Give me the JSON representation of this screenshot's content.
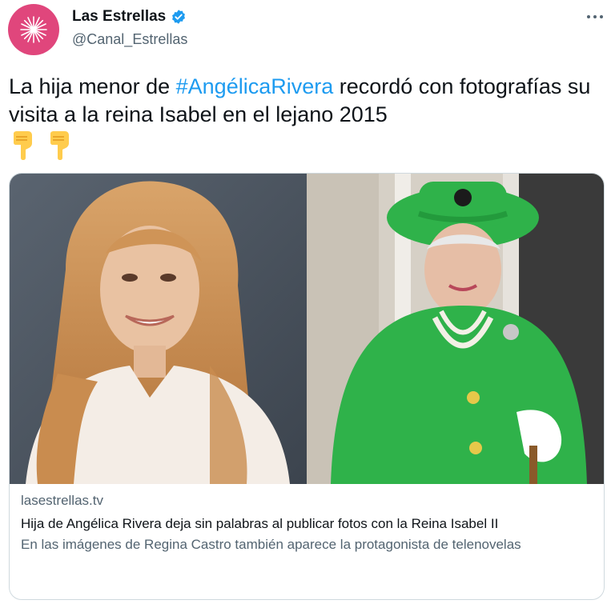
{
  "author": {
    "display_name": "Las Estrellas",
    "handle": "@Canal_Estrellas",
    "avatar_color": "#e0467c",
    "verified": true
  },
  "menu": {
    "more_icon": "more-horizontal-icon"
  },
  "tweet": {
    "text_before": "La hija menor de ",
    "hashtag": "#AngélicaRivera",
    "text_after": " recordó con fotografías su visita a la reina Isabel en el lejano 2015",
    "emojis": [
      "👇",
      "👇"
    ]
  },
  "card": {
    "domain": "lasestrellas.tv",
    "title": "Hija de Angélica Rivera deja sin palabras al publicar fotos con la Reina Isabel II",
    "description": "En las imágenes de Regina Castro también aparece la protagonista de telenovelas"
  },
  "colors": {
    "link": "#1d9bf0",
    "secondary_text": "#536471",
    "border": "#cfd9de",
    "queen_green": "#2fb24a"
  }
}
